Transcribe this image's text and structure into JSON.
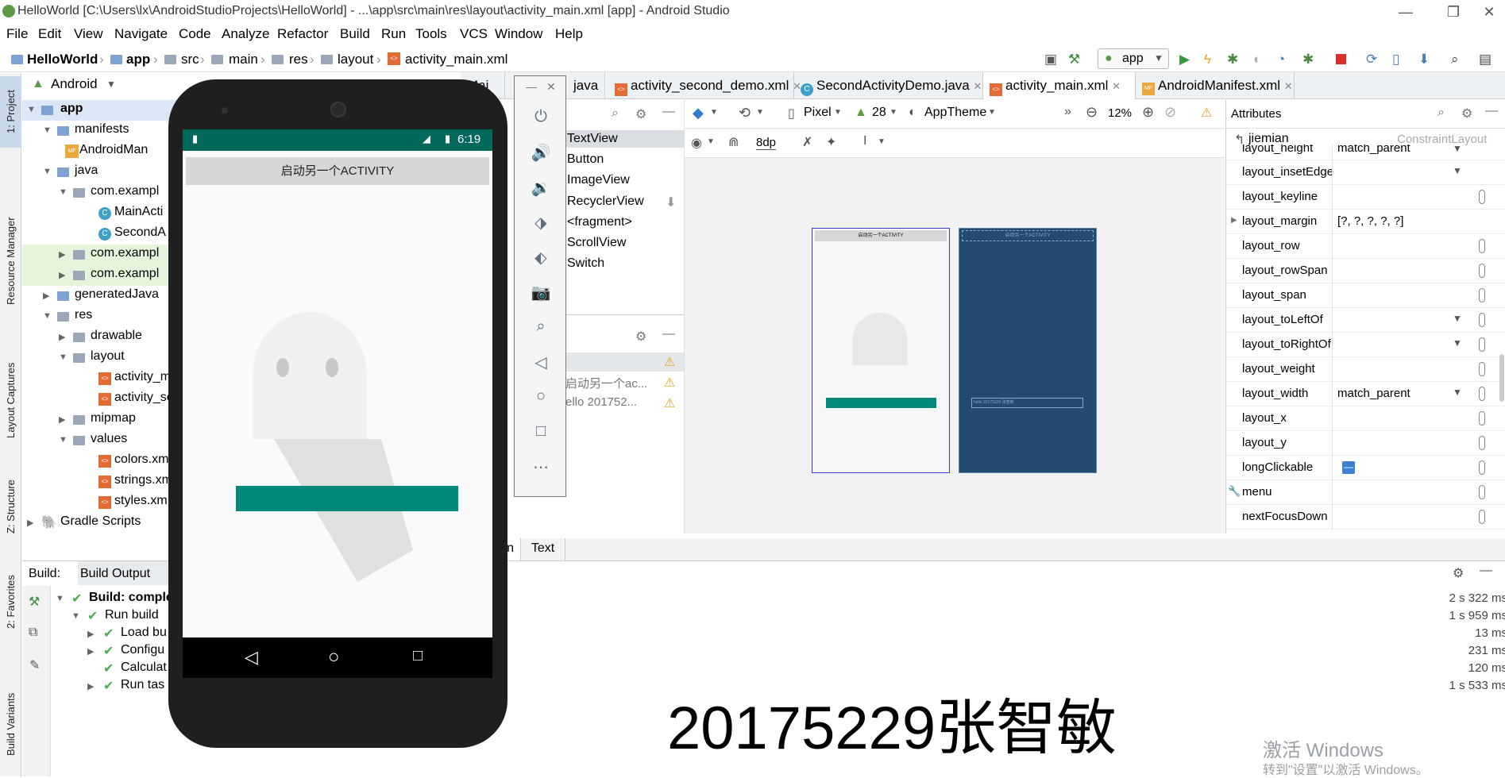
{
  "window": {
    "title": "HelloWorld [C:\\Users\\lx\\AndroidStudioProjects\\HelloWorld] - ...\\app\\src\\main\\res\\layout\\activity_main.xml [app] - Android Studio",
    "controls": [
      "—",
      "❐",
      "✕"
    ]
  },
  "menu": [
    "File",
    "Edit",
    "View",
    "Navigate",
    "Code",
    "Analyze",
    "Refactor",
    "Build",
    "Run",
    "Tools",
    "VCS",
    "Window",
    "Help"
  ],
  "breadcrumb": [
    "HelloWorld",
    "app",
    "src",
    "main",
    "res",
    "layout",
    "activity_main.xml"
  ],
  "run_config": "app",
  "side_tabs": [
    "1: Project",
    "Resource Manager",
    "Layout Captures",
    "Z: Structure",
    "2: Favorites",
    "Build Variants"
  ],
  "project": {
    "view_selector": "Android",
    "tree": [
      {
        "label": "app",
        "level": 0,
        "expanded": true,
        "bold": true
      },
      {
        "label": "manifests",
        "level": 1,
        "expanded": true
      },
      {
        "label": "AndroidMan",
        "level": 2
      },
      {
        "label": "java",
        "level": 1,
        "expanded": true
      },
      {
        "label": "com.exampl",
        "level": 2,
        "expanded": true
      },
      {
        "label": "MainActi",
        "level": 3
      },
      {
        "label": "SecondA",
        "level": 3
      },
      {
        "label": "com.exampl",
        "level": 2,
        "highlight": true
      },
      {
        "label": "com.exampl",
        "level": 2,
        "highlight": true
      },
      {
        "label": "generatedJava",
        "level": 1
      },
      {
        "label": "res",
        "level": 1,
        "expanded": true
      },
      {
        "label": "drawable",
        "level": 2
      },
      {
        "label": "layout",
        "level": 2,
        "expanded": true
      },
      {
        "label": "activity_m",
        "level": 3
      },
      {
        "label": "activity_se",
        "level": 3
      },
      {
        "label": "mipmap",
        "level": 2
      },
      {
        "label": "values",
        "level": 2,
        "expanded": true
      },
      {
        "label": "colors.xm",
        "level": 3
      },
      {
        "label": "strings.xm",
        "level": 3
      },
      {
        "label": "styles.xm",
        "level": 3
      },
      {
        "label": "Gradle Scripts",
        "level": 0
      }
    ]
  },
  "editor_tabs": [
    {
      "label": "Mai",
      "active": false
    },
    {
      "label": "java",
      "active": false
    },
    {
      "label": "activity_second_demo.xml",
      "active": false
    },
    {
      "label": "SecondActivityDemo.java",
      "active": false
    },
    {
      "label": "activity_main.xml",
      "active": true
    },
    {
      "label": "AndroidManifest.xml",
      "active": false
    }
  ],
  "palette": {
    "items": [
      "TextView",
      "Button",
      "ImageView",
      "RecyclerView",
      "<fragment>",
      "ScrollView",
      "Switch"
    ],
    "tree_items": [
      "启动另一个ac...",
      "ello 201752..."
    ]
  },
  "design_toolbar": {
    "device": "Pixel",
    "api": "28",
    "theme": "AppTheme",
    "zoom": "12%",
    "margin": "8dp"
  },
  "attributes": {
    "title": "Attributes",
    "component": "jiemian",
    "layout_type": "ConstraintLayout",
    "rows": [
      {
        "name": "layout_height",
        "value": "match_parent",
        "dropdown": true
      },
      {
        "name": "layout_insetEdge",
        "value": "",
        "dropdown": true
      },
      {
        "name": "layout_keyline",
        "value": ""
      },
      {
        "name": "layout_margin",
        "value": "[?, ?, ?, ?, ?]",
        "expand": true
      },
      {
        "name": "layout_row",
        "value": ""
      },
      {
        "name": "layout_rowSpan",
        "value": ""
      },
      {
        "name": "layout_span",
        "value": ""
      },
      {
        "name": "layout_toLeftOf",
        "value": "",
        "dropdown": true
      },
      {
        "name": "layout_toRightOf",
        "value": "",
        "dropdown": true
      },
      {
        "name": "layout_weight",
        "value": ""
      },
      {
        "name": "layout_width",
        "value": "match_parent",
        "dropdown": true
      },
      {
        "name": "layout_x",
        "value": ""
      },
      {
        "name": "layout_y",
        "value": ""
      },
      {
        "name": "longClickable",
        "value": "",
        "checkbox": true
      },
      {
        "name": "menu",
        "value": ""
      },
      {
        "name": "nextFocusDown",
        "value": ""
      }
    ]
  },
  "design_tabs": [
    "gn",
    "Text"
  ],
  "build": {
    "tab_label": "Build:",
    "output_label": "Build Output",
    "rows": [
      {
        "label": "Build: comple",
        "time": "2 s 322 ms",
        "level": 0
      },
      {
        "label": "Run build",
        "time": "1 s 959 ms",
        "level": 1
      },
      {
        "label": "Load bu",
        "time": "13 ms",
        "level": 2
      },
      {
        "label": "Configu",
        "time": "231 ms",
        "level": 2
      },
      {
        "label": "Calculat",
        "time": "120 ms",
        "level": 2
      },
      {
        "label": "Run tas",
        "time": "1 s 533 ms",
        "level": 2
      }
    ]
  },
  "emulator": {
    "status_time": "6:19",
    "button_label": "启动另一个ACTIVITY",
    "preview_button_label": "启动另一个ACTIVITY",
    "preview_text": "hello 20175229 张智敏"
  },
  "overlay_text": "20175229张智敏",
  "watermark": {
    "line1": "激活 Windows",
    "line2": "转到\"设置\"以激活 Windows。"
  },
  "colors": {
    "teal": "#00897b",
    "blueprint": "#234b6e",
    "statusbar": "#00695c"
  }
}
